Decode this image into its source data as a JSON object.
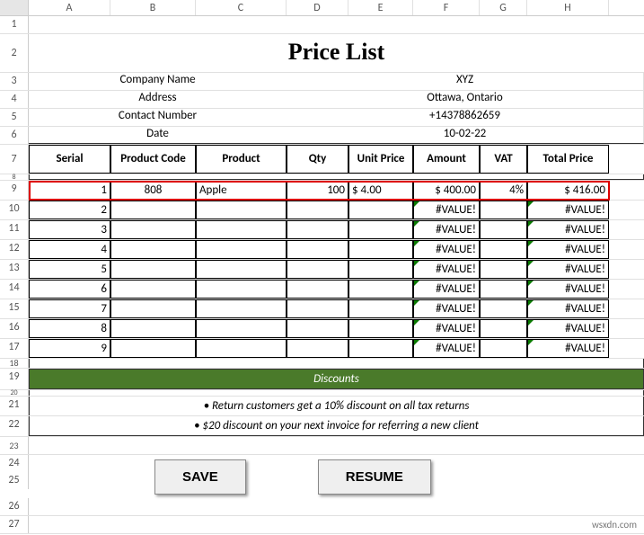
{
  "columns": [
    "A",
    "B",
    "C",
    "D",
    "E",
    "F",
    "G",
    "H"
  ],
  "title": "Price List",
  "info": {
    "company_label": "Company Name",
    "company_value": "XYZ",
    "address_label": "Address",
    "address_value": "Ottawa, Ontario",
    "contact_label": "Contact Number",
    "contact_value": "+14378862659",
    "date_label": "Date",
    "date_value": "10-02-22"
  },
  "headers": {
    "serial": "Serial",
    "code": "Product Code",
    "product": "Product",
    "qty": "Qty",
    "unit_price": "Unit Price",
    "amount": "Amount",
    "vat": "VAT",
    "total": "Total Price"
  },
  "rows": [
    {
      "serial": "1",
      "code": "808",
      "product": "Apple",
      "qty": "100",
      "unit_price": "$       4.00",
      "amount": "$   400.00",
      "vat": "4%",
      "total": "$     416.00",
      "highlight": true
    },
    {
      "serial": "2",
      "code": "",
      "product": "",
      "qty": "",
      "unit_price": "",
      "amount": "#VALUE!",
      "vat": "",
      "total": "#VALUE!"
    },
    {
      "serial": "3",
      "code": "",
      "product": "",
      "qty": "",
      "unit_price": "",
      "amount": "#VALUE!",
      "vat": "",
      "total": "#VALUE!"
    },
    {
      "serial": "4",
      "code": "",
      "product": "",
      "qty": "",
      "unit_price": "",
      "amount": "#VALUE!",
      "vat": "",
      "total": "#VALUE!"
    },
    {
      "serial": "5",
      "code": "",
      "product": "",
      "qty": "",
      "unit_price": "",
      "amount": "#VALUE!",
      "vat": "",
      "total": "#VALUE!"
    },
    {
      "serial": "6",
      "code": "",
      "product": "",
      "qty": "",
      "unit_price": "",
      "amount": "#VALUE!",
      "vat": "",
      "total": "#VALUE!"
    },
    {
      "serial": "7",
      "code": "",
      "product": "",
      "qty": "",
      "unit_price": "",
      "amount": "#VALUE!",
      "vat": "",
      "total": "#VALUE!"
    },
    {
      "serial": "8",
      "code": "",
      "product": "",
      "qty": "",
      "unit_price": "",
      "amount": "#VALUE!",
      "vat": "",
      "total": "#VALUE!"
    },
    {
      "serial": "9",
      "code": "",
      "product": "",
      "qty": "",
      "unit_price": "",
      "amount": "#VALUE!",
      "vat": "",
      "total": "#VALUE!"
    }
  ],
  "discounts": {
    "header": "Discounts",
    "line1": "• Return customers get a 10% discount on all tax returns",
    "line2": "• $20 discount on your next invoice for referring a new client"
  },
  "buttons": {
    "save": "SAVE",
    "resume": "RESUME"
  },
  "watermark": "wsxdn.com"
}
